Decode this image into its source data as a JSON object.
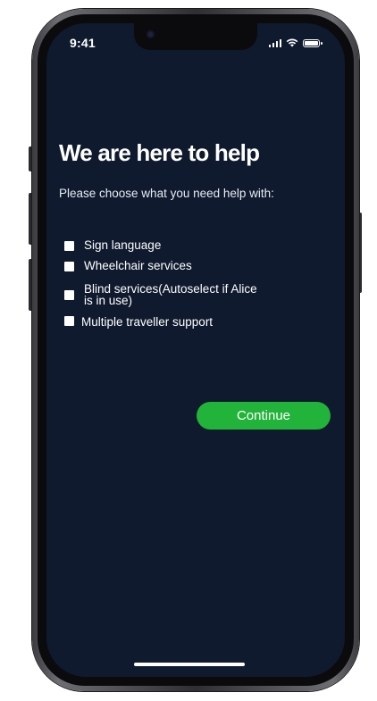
{
  "status_bar": {
    "time": "9:41",
    "icons": [
      "cellular-signal-icon",
      "wifi-icon",
      "battery-icon"
    ]
  },
  "main": {
    "title": "We are here to help",
    "subtitle": "Please choose what you need help with:",
    "options": [
      {
        "label": "Sign language",
        "checked": false
      },
      {
        "label": "Wheelchair services",
        "checked": false
      },
      {
        "label": "Blind services(Autoselect if Alice is in use)",
        "checked": false
      },
      {
        "label": "Multiple traveller support",
        "checked": false
      }
    ],
    "continue_label": "Continue"
  },
  "colors": {
    "screen_background": "#0f1a2e",
    "accent_green": "#22b33a",
    "text": "#ffffff"
  }
}
